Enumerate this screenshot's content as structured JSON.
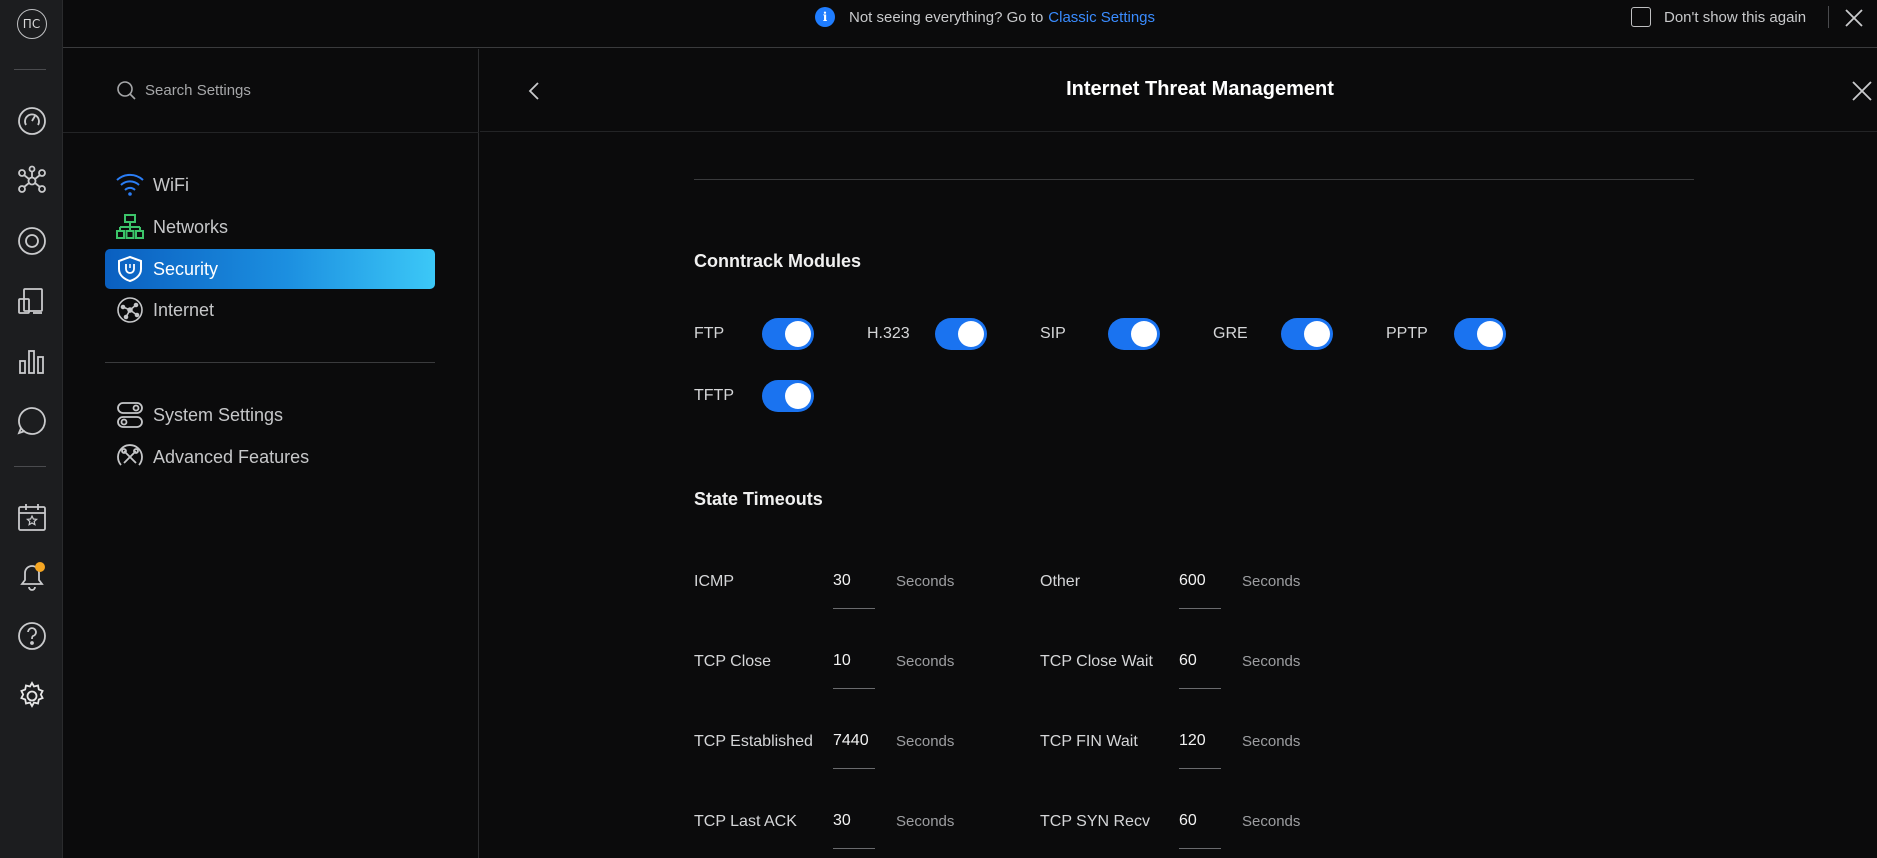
{
  "rail": {
    "avatar_initials": "ПС"
  },
  "banner": {
    "message": "Not seeing everything? Go to",
    "link": "Classic Settings",
    "dont_show": "Don't show this again"
  },
  "sidebar": {
    "search_placeholder": "Search Settings",
    "items": [
      {
        "label": "WiFi",
        "icon": "wifi-icon"
      },
      {
        "label": "Networks",
        "icon": "networks-icon"
      },
      {
        "label": "Security",
        "icon": "shield-icon",
        "active": true
      },
      {
        "label": "Internet",
        "icon": "globe-icon"
      }
    ],
    "items2": [
      {
        "label": "System Settings",
        "icon": "toggles-icon"
      },
      {
        "label": "Advanced Features",
        "icon": "tools-icon"
      }
    ]
  },
  "main": {
    "title": "Internet Threat Management",
    "conntrack": {
      "title": "Conntrack Modules",
      "modules": [
        {
          "label": "FTP",
          "on": true
        },
        {
          "label": "H.323",
          "on": true
        },
        {
          "label": "SIP",
          "on": true
        },
        {
          "label": "GRE",
          "on": true
        },
        {
          "label": "PPTP",
          "on": true
        },
        {
          "label": "TFTP",
          "on": true
        }
      ]
    },
    "timeouts": {
      "title": "State Timeouts",
      "unit": "Seconds",
      "rows": [
        {
          "label": "ICMP",
          "value": "30"
        },
        {
          "label": "Other",
          "value": "600"
        },
        {
          "label": "TCP Close",
          "value": "10"
        },
        {
          "label": "TCP Close Wait",
          "value": "60"
        },
        {
          "label": "TCP Established",
          "value": "7440"
        },
        {
          "label": "TCP FIN Wait",
          "value": "120"
        },
        {
          "label": "TCP Last ACK",
          "value": "30"
        },
        {
          "label": "TCP SYN Recv",
          "value": "60"
        }
      ]
    }
  },
  "colors": {
    "accent": "#1a73f0",
    "link": "#3a8cff",
    "notification_dot": "#f5a623"
  }
}
